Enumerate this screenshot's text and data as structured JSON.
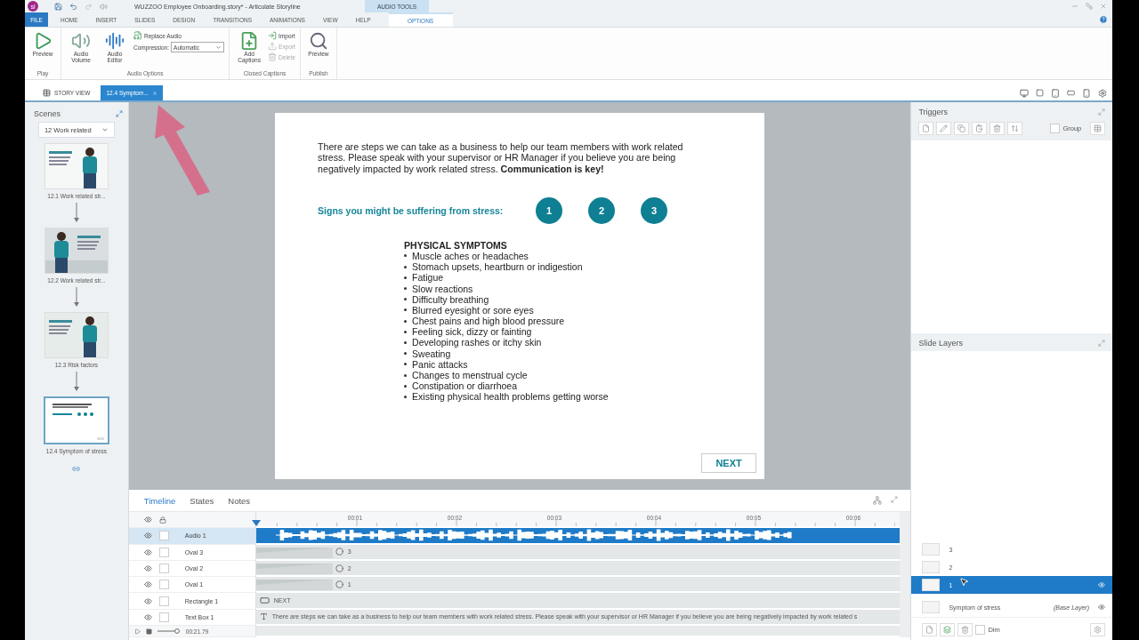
{
  "window": {
    "app_badge": "sl",
    "title": "WUZZOO Employee Onboarding.story* - Articulate Storyline"
  },
  "ribbon": {
    "context_group": "AUDIO TOOLS",
    "tabs": [
      {
        "label": "FILE",
        "kind": "file",
        "selected": false
      },
      {
        "label": "HOME",
        "kind": "tab",
        "selected": false
      },
      {
        "label": "INSERT",
        "kind": "tab",
        "selected": false
      },
      {
        "label": "SLIDES",
        "kind": "tab",
        "selected": false
      },
      {
        "label": "DESIGN",
        "kind": "tab",
        "selected": false
      },
      {
        "label": "TRANSITIONS",
        "kind": "tab",
        "selected": false
      },
      {
        "label": "ANIMATIONS",
        "kind": "tab",
        "selected": false
      },
      {
        "label": "VIEW",
        "kind": "tab",
        "selected": false
      },
      {
        "label": "HELP",
        "kind": "tab",
        "selected": false
      },
      {
        "label": "OPTIONS",
        "kind": "context",
        "selected": true
      }
    ],
    "groups": [
      {
        "label": "Play",
        "items": [
          {
            "kind": "large",
            "label": "Preview"
          }
        ]
      },
      {
        "label": "Audio Options",
        "items": [
          {
            "kind": "large",
            "label": "Audio Volume"
          },
          {
            "kind": "large",
            "label": "Audio Editor"
          },
          {
            "kind": "small",
            "label": "Replace Audio",
            "disabled": false
          },
          {
            "kind": "select",
            "label": "Compression:",
            "value": "Automatic"
          }
        ]
      },
      {
        "label": "Closed Captions",
        "items": [
          {
            "kind": "large",
            "label": "Add Captions"
          },
          {
            "kind": "small",
            "label": "Import",
            "disabled": false
          },
          {
            "kind": "small",
            "label": "Export",
            "disabled": true
          },
          {
            "kind": "small",
            "label": "Delete",
            "disabled": true
          }
        ]
      },
      {
        "label": "Publish",
        "items": [
          {
            "kind": "large",
            "label": "Preview"
          }
        ]
      }
    ]
  },
  "view_tabs": [
    {
      "label": "STORY VIEW",
      "selected": false
    },
    {
      "label": "12.4 Symptom...",
      "selected": true
    }
  ],
  "scenes": {
    "title": "Scenes",
    "scene": "12 Work related",
    "slides": [
      {
        "caption": "12.1 Work related str...",
        "kind": "picture",
        "selected": false
      },
      {
        "caption": "12.2 Work related str...",
        "kind": "picture",
        "selected": false
      },
      {
        "caption": "12.3 Risk factors",
        "kind": "picture",
        "selected": false
      },
      {
        "caption": "12.4 Symptom of stress",
        "kind": "layout",
        "selected": true
      }
    ]
  },
  "slide": {
    "intro": "There are steps we can take as a business to help our team members with work related stress. Please speak with your supervisor or HR Manager if you believe you are being negatively impacted by work related stress. **Communication is key!**",
    "signs_label": "Signs you might be suffering from stress:",
    "sign_buttons": [
      "1",
      "2",
      "3"
    ],
    "heading": "PHYSICAL SYMPTOMS",
    "symptoms": [
      "Muscle aches or headaches",
      "Stomach upsets, heartburn or indigestion",
      "Fatigue",
      "Slow reactions",
      "Difficulty breathing",
      "Blurred eyesight or sore eyes",
      "Chest pains and high blood pressure",
      "Feeling sick, dizzy or fainting",
      "Developing rashes or itchy skin",
      "Sweating",
      "Panic attacks",
      "Changes to menstrual cycle",
      "Constipation or diarrhoea",
      "Existing physical health problems getting worse"
    ],
    "next_button": "NEXT"
  },
  "timeline": {
    "tabs": [
      {
        "label": "Timeline",
        "selected": true
      },
      {
        "label": "States",
        "selected": false
      },
      {
        "label": "Notes",
        "selected": false
      }
    ],
    "ticks": [
      "00:01",
      "00:02",
      "00:03",
      "00:04",
      "00:05",
      "00:06"
    ],
    "rows": [
      {
        "name": "Audio 1",
        "kind": "audio",
        "selected": true
      },
      {
        "name": "Oval 3",
        "kind": "oval",
        "label": "3",
        "selected": false
      },
      {
        "name": "Oval 2",
        "kind": "oval",
        "label": "2",
        "selected": false
      },
      {
        "name": "Oval 1",
        "kind": "oval",
        "label": "1",
        "selected": false
      },
      {
        "name": "Rectangle 1",
        "kind": "rectangle",
        "label": "NEXT",
        "selected": false
      },
      {
        "name": "Text Box 1",
        "kind": "text",
        "label": "There are steps we can take as a business to help our team members with work related stress. Please speak with your supervisor or HR Manager if you believe you are being negatively impacted by work related s",
        "selected": false
      }
    ],
    "duration": "00:21.79"
  },
  "triggers": {
    "title": "Triggers",
    "group_label": "Group",
    "group_checked": false
  },
  "slide_layers": {
    "title": "Slide Layers",
    "layers": [
      {
        "name": "3",
        "selected": false
      },
      {
        "name": "2",
        "selected": false
      },
      {
        "name": "1",
        "selected": true
      },
      {
        "name": "Symptom of stress",
        "note": "(Base Layer)",
        "selected": false
      }
    ],
    "dim_label": "Dim",
    "dim_checked": false
  }
}
